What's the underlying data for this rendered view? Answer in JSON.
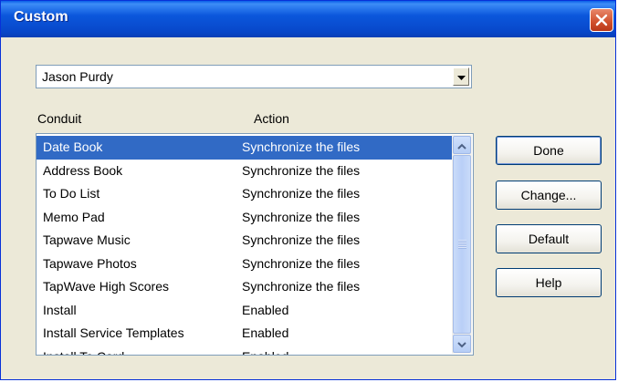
{
  "window": {
    "title": "Custom"
  },
  "user_select": {
    "selected": "Jason Purdy"
  },
  "headers": {
    "conduit": "Conduit",
    "action": "Action"
  },
  "conduits": [
    {
      "conduit": "Date Book",
      "action": "Synchronize the files",
      "selected": true
    },
    {
      "conduit": "Address Book",
      "action": "Synchronize the files"
    },
    {
      "conduit": "To Do List",
      "action": "Synchronize the files"
    },
    {
      "conduit": "Memo Pad",
      "action": "Synchronize the files"
    },
    {
      "conduit": "Tapwave Music",
      "action": "Synchronize the files"
    },
    {
      "conduit": "Tapwave Photos",
      "action": "Synchronize the files"
    },
    {
      "conduit": "TapWave High Scores",
      "action": "Synchronize the files"
    },
    {
      "conduit": "Install",
      "action": "Enabled"
    },
    {
      "conduit": "Install Service Templates",
      "action": "Enabled"
    },
    {
      "conduit": "Install To Card",
      "action": "Enabled"
    }
  ],
  "buttons": {
    "done": "Done",
    "change": "Change...",
    "default": "Default",
    "help": "Help"
  },
  "colors": {
    "selection": "#316ac5",
    "titlebar": "#0b57dc",
    "dialog_bg": "#ece9d8",
    "close_button": "#d0502d"
  },
  "icons": {
    "close": "close-icon",
    "dropdown": "chevron-down-icon",
    "scroll_up": "chevron-up-icon",
    "scroll_down": "chevron-down-icon"
  }
}
